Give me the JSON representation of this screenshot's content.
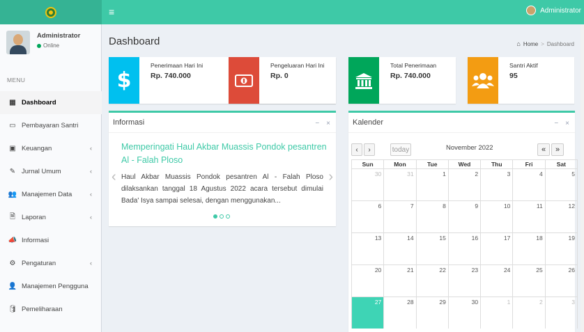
{
  "header": {
    "menu_icon": "bars-icon",
    "user_name": "Administrator"
  },
  "sidebar": {
    "user_name": "Administrator",
    "status": "Online",
    "menu_header": "MENU",
    "items": [
      {
        "label": "Dashboard",
        "icon": "grid-icon",
        "glyph": "▦",
        "has_children": false,
        "active": true
      },
      {
        "label": "Pembayaran Santri",
        "icon": "credit-card-icon",
        "glyph": "▭",
        "has_children": false
      },
      {
        "label": "Keuangan",
        "icon": "money-icon",
        "glyph": "▣",
        "has_children": true
      },
      {
        "label": "Jurnal Umum",
        "icon": "edit-icon",
        "glyph": "✎",
        "has_children": true
      },
      {
        "label": "Manajemen Data",
        "icon": "users-icon",
        "glyph": "👥",
        "has_children": true
      },
      {
        "label": "Laporan",
        "icon": "file-icon",
        "glyph": "🗎",
        "has_children": true
      },
      {
        "label": "Informasi",
        "icon": "bullhorn-icon",
        "glyph": "📣",
        "has_children": false
      },
      {
        "label": "Pengaturan",
        "icon": "gear-icon",
        "glyph": "⚙",
        "has_children": true
      },
      {
        "label": "Manajemen Pengguna",
        "icon": "user-icon",
        "glyph": "👤",
        "has_children": false
      },
      {
        "label": "Pemeliharaan",
        "icon": "database-icon",
        "glyph": "🛢",
        "has_children": false
      }
    ],
    "chevron": "‹"
  },
  "content": {
    "title": "Dashboard",
    "breadcrumb": {
      "home": "Home",
      "separator": ">",
      "current": "Dashboard"
    }
  },
  "info_boxes": [
    {
      "label": "Penerimaan Hari Ini",
      "value": "Rp. 740.000",
      "icon": "dollar-icon",
      "color": "#00c0ef"
    },
    {
      "label": "Pengeluaran Hari Ini",
      "value": "Rp. 0",
      "icon": "money-bill-icon",
      "color": "#dd4b39"
    },
    {
      "label": "Total Penerimaan",
      "value": "Rp. 740.000",
      "icon": "bank-icon",
      "color": "#00a65a"
    },
    {
      "label": "Santri Aktif",
      "value": "95",
      "icon": "users-icon",
      "color": "#f39c12"
    }
  ],
  "informasi": {
    "title": "Informasi",
    "minimize": "−",
    "close": "×",
    "headline": "Memperingati Haul Akbar Muassis Pondok pesantren Al - Falah Ploso",
    "text": "Haul Akbar Muassis Pondok pesantren Al - Falah Ploso dilaksankan tanggal 18 Agustus 2022 acara tersebut dimulai Bada' Isya sampai selesai, dengan menggunakan...",
    "prev": "‹",
    "next": "›"
  },
  "kalender": {
    "title": "Kalender",
    "minimize": "−",
    "close": "×",
    "prev": "‹",
    "next": "›",
    "today": "today",
    "month": "November 2022",
    "view_prev": "«",
    "view_next": "»",
    "days": [
      "Sun",
      "Mon",
      "Tue",
      "Wed",
      "Thu",
      "Fri",
      "Sat"
    ],
    "weeks": [
      [
        "30",
        "31",
        "1",
        "2",
        "3",
        "4",
        "5"
      ],
      [
        "6",
        "7",
        "8",
        "9",
        "10",
        "11",
        "12"
      ],
      [
        "13",
        "14",
        "15",
        "16",
        "17",
        "18",
        "19"
      ],
      [
        "20",
        "21",
        "22",
        "23",
        "24",
        "25",
        "26"
      ],
      [
        "27",
        "28",
        "29",
        "30",
        "1",
        "2",
        "3"
      ]
    ],
    "today_date": "27",
    "colors": {
      "today_bg": "#3ed4b5",
      "accent": "#3ec9a7"
    }
  }
}
